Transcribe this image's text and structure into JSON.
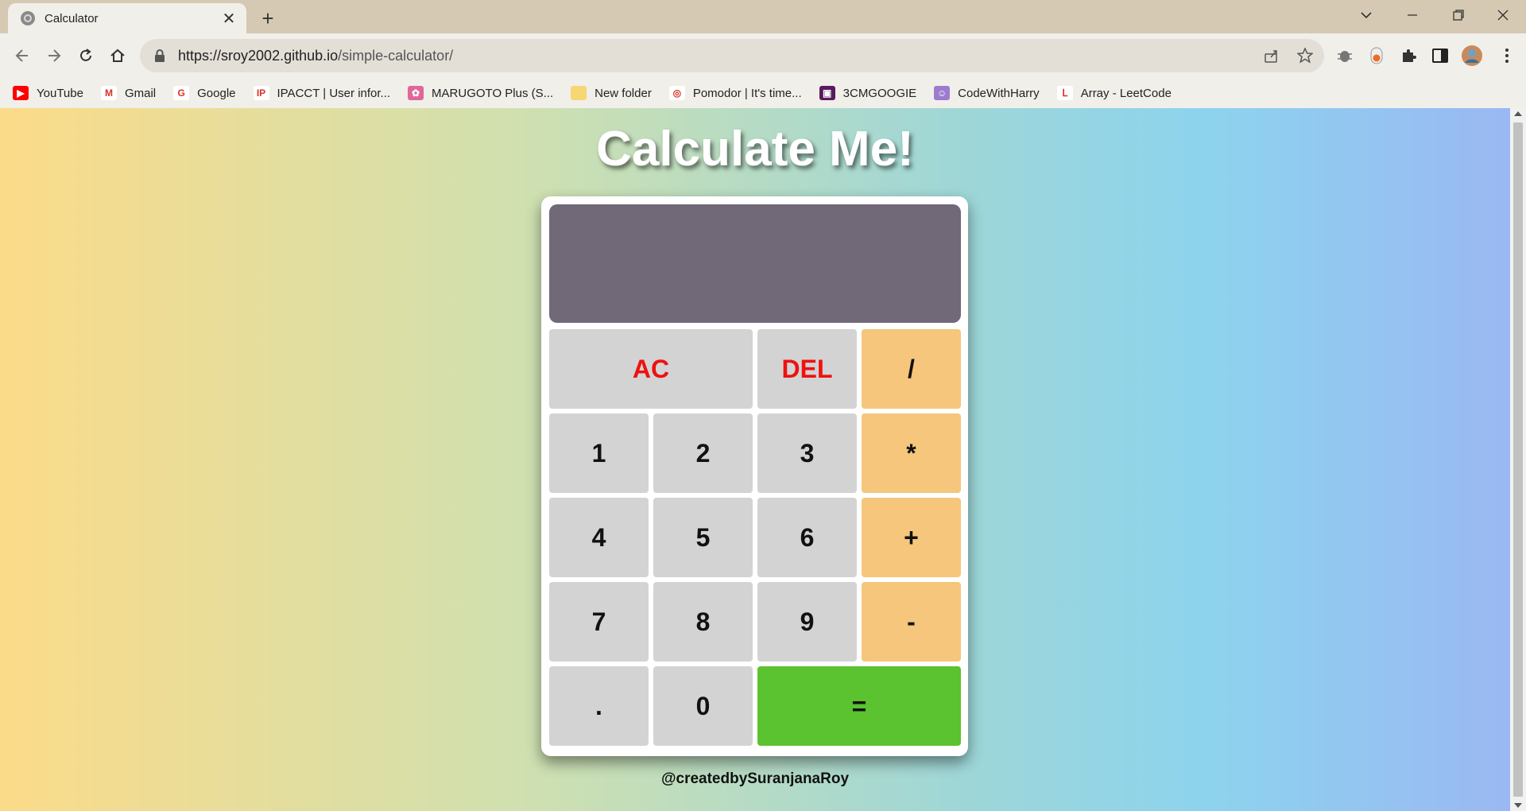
{
  "browser": {
    "tab_title": "Calculator",
    "tab_close": "✕",
    "new_tab": "+",
    "url_host": "https://sroy2002.github.io",
    "url_path": "/simple-calculator/",
    "bookmarks": [
      {
        "label": "YouTube",
        "icon": "youtube-icon",
        "color": "#ff0000",
        "glyph": "▶"
      },
      {
        "label": "Gmail",
        "icon": "gmail-icon",
        "color": "#ffffff",
        "glyph": "M"
      },
      {
        "label": "Google",
        "icon": "google-icon",
        "color": "#ffffff",
        "glyph": "G"
      },
      {
        "label": "IPACCT | User infor...",
        "icon": "ipacct-icon",
        "color": "#ffffff",
        "glyph": "IP"
      },
      {
        "label": "MARUGOTO Plus (S...",
        "icon": "marugoto-icon",
        "color": "#e0679a",
        "glyph": "✿"
      },
      {
        "label": "New folder",
        "icon": "folder-icon",
        "color": "#f7d774",
        "glyph": ""
      },
      {
        "label": "Pomodor | It's time...",
        "icon": "pomodoro-icon",
        "color": "#ffffff",
        "glyph": "◎"
      },
      {
        "label": "3CMGOOGIE",
        "icon": "3cm-icon",
        "color": "#5a1a5e",
        "glyph": "▣"
      },
      {
        "label": "CodeWithHarry",
        "icon": "codewithharry-icon",
        "color": "#9b7ccf",
        "glyph": "☺"
      },
      {
        "label": "Array - LeetCode",
        "icon": "leetcode-icon",
        "color": "#ffffff",
        "glyph": "ᒪ"
      }
    ]
  },
  "page": {
    "heading": "Calculate Me!",
    "display_value": "",
    "footer": "@createdbySuranjanaRoy",
    "keys": [
      {
        "label": "AC",
        "name": "key-ac",
        "style": "red",
        "span": 2
      },
      {
        "label": "DEL",
        "name": "key-del",
        "style": "red",
        "span": 1
      },
      {
        "label": "/",
        "name": "key-divide",
        "style": "op",
        "span": 1
      },
      {
        "label": "1",
        "name": "key-1",
        "style": "",
        "span": 1
      },
      {
        "label": "2",
        "name": "key-2",
        "style": "",
        "span": 1
      },
      {
        "label": "3",
        "name": "key-3",
        "style": "",
        "span": 1
      },
      {
        "label": "*",
        "name": "key-multiply",
        "style": "op",
        "span": 1
      },
      {
        "label": "4",
        "name": "key-4",
        "style": "",
        "span": 1
      },
      {
        "label": "5",
        "name": "key-5",
        "style": "",
        "span": 1
      },
      {
        "label": "6",
        "name": "key-6",
        "style": "",
        "span": 1
      },
      {
        "label": "+",
        "name": "key-plus",
        "style": "op",
        "span": 1
      },
      {
        "label": "7",
        "name": "key-7",
        "style": "",
        "span": 1
      },
      {
        "label": "8",
        "name": "key-8",
        "style": "",
        "span": 1
      },
      {
        "label": "9",
        "name": "key-9",
        "style": "",
        "span": 1
      },
      {
        "label": "-",
        "name": "key-minus",
        "style": "op",
        "span": 1
      },
      {
        "label": ".",
        "name": "key-decimal",
        "style": "",
        "span": 1
      },
      {
        "label": "0",
        "name": "key-0",
        "style": "",
        "span": 1
      },
      {
        "label": "=",
        "name": "key-equals",
        "style": "eq",
        "span": 2
      }
    ]
  },
  "colors": {
    "display": "#716878",
    "key": "#d3d3d3",
    "operator": "#f5c67b",
    "equals": "#5bc230",
    "danger_text": "#ee1111"
  }
}
